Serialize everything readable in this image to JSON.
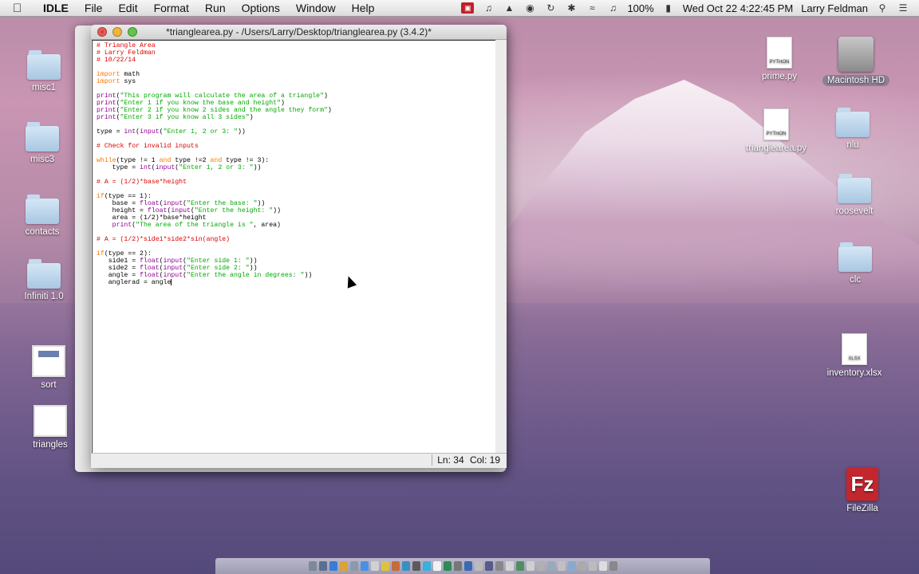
{
  "menubar": {
    "app": "IDLE",
    "items": [
      "File",
      "Edit",
      "Format",
      "Run",
      "Options",
      "Window",
      "Help"
    ],
    "battery": "100%",
    "datetime": "Wed Oct 22  4:22:45 PM",
    "user": "Larry Feldman"
  },
  "desktop": {
    "left_icons": [
      {
        "label": "misc1",
        "kind": "folder"
      },
      {
        "label": "misc3",
        "kind": "folder"
      },
      {
        "label": "contacts",
        "kind": "folder"
      },
      {
        "label": "Infiniti 1.0",
        "kind": "folder"
      },
      {
        "label": "sort",
        "kind": "thumb"
      },
      {
        "label": "triangles",
        "kind": "thumb"
      }
    ],
    "right_icons": [
      {
        "label": "prime.py",
        "kind": "doc",
        "badge": "PYTHON"
      },
      {
        "label": "Macintosh HD",
        "kind": "disk"
      },
      {
        "label": "trianglearea.py",
        "kind": "doc",
        "badge": "PYTHON"
      },
      {
        "label": "nlu",
        "kind": "folder"
      },
      {
        "label": "roosevelt",
        "kind": "folder"
      },
      {
        "label": "clc",
        "kind": "folder"
      },
      {
        "label": "inventory.xlsx",
        "kind": "doc",
        "badge": "XLSX"
      },
      {
        "label": "FileZilla",
        "kind": "app",
        "glyph": "Fz"
      }
    ]
  },
  "window": {
    "title": "*trianglearea.py - /Users/Larry/Desktop/trianglearea.py (3.4.2)*",
    "status": {
      "line": "Ln: 34",
      "col": "Col: 19"
    }
  },
  "code_lines": [
    "# Triangle Area",
    "# Larry Feldman",
    "# 10/22/14",
    "",
    "import math",
    "import sys",
    "",
    "print(\"This program will calculate the area of a triangle\")",
    "print(\"Enter 1 if you know the base and height\")",
    "print(\"Enter 2 if you know 2 sides and the angle they form\")",
    "print(\"Enter 3 if you know all 3 sides\")",
    "",
    "type = int(input(\"Enter 1, 2 or 3: \"))",
    "",
    "# Check for invalid inputs",
    "",
    "while(type != 1 and type !=2 and type != 3):",
    "    type = int(input(\"Enter 1, 2 or 3: \"))",
    "",
    "# A = (1/2)*base*height",
    "",
    "if(type == 1):",
    "    base = float(input(\"Enter the base: \"))",
    "    height = float(input(\"Enter the height: \"))",
    "    area = (1/2)*base*height",
    "    print(\"The area of the triangle is \", area)",
    "",
    "# A = (1/2)*side1*side2*sin(angle)",
    "",
    "if(type == 2):",
    "   side1 = float(input(\"Enter side 1: \"))",
    "   side2 = float(input(\"Enter side 2: \"))",
    "   angle = float(input(\"Enter the angle in degrees: \"))",
    "   anglerad = angle"
  ]
}
